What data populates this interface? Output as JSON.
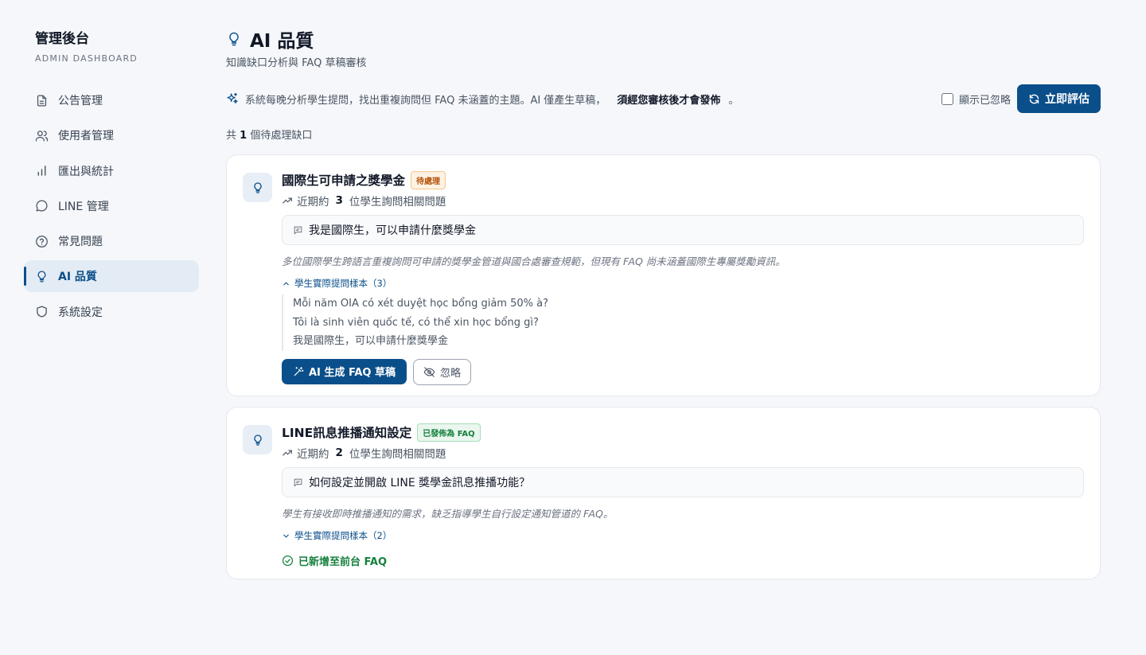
{
  "sidebar": {
    "title": "管理後台",
    "subtitle": "ADMIN DASHBOARD",
    "items": [
      {
        "label": "公告管理",
        "icon": "document-icon"
      },
      {
        "label": "使用者管理",
        "icon": "users-icon"
      },
      {
        "label": "匯出與統計",
        "icon": "bar-chart-icon"
      },
      {
        "label": "LINE 管理",
        "icon": "chat-bubble-icon"
      },
      {
        "label": "常見問題",
        "icon": "help-circle-icon"
      },
      {
        "label": "AI 品質",
        "icon": "lightbulb-icon",
        "active": true
      },
      {
        "label": "系統設定",
        "icon": "shield-icon"
      }
    ]
  },
  "header": {
    "title": "AI 品質",
    "subtitle": "知識缺口分析與 FAQ 草稿審核"
  },
  "info": {
    "text": "系統每晚分析學生提問，找出重複詢問但 FAQ 未涵蓋的主題。AI 僅產生草稿，",
    "bold": "須經您審核後才會發佈",
    "end": "。",
    "show_ignored_label": "顯示已忽略",
    "show_ignored_checked": false,
    "evaluate_button": "立即評估"
  },
  "count": {
    "prefix": "共",
    "number": "1",
    "suffix": "個待處理缺口"
  },
  "gaps": [
    {
      "title": "國際生可申請之獎學金",
      "badge": "待處理",
      "trend_prefix": "近期約",
      "trend_count": "3",
      "trend_suffix": "位學生詢問相關問題",
      "question": "我是國際生，可以申請什麼獎學金",
      "description": "多位國際學生跨語言重複詢問可申請的獎學金管道與國合處審查規範，但現有 FAQ 尚未涵蓋國際生專屬獎勵資訊。",
      "samples_label": "學生實際提問樣本（3）",
      "samples_expanded": true,
      "samples": [
        "Mỗi năm OIA có xét duyệt học bổng giảm 50% à?",
        "Tôi là sinh viên quốc tế, có thể xin học bổng gì?",
        "我是國際生，可以申請什麼獎學金"
      ],
      "ai_button": "AI 生成 FAQ 草稿",
      "ignore_button": "忽略"
    },
    {
      "title": "LINE訊息推播通知設定",
      "badge": "已發佈為 FAQ",
      "trend_prefix": "近期約",
      "trend_count": "2",
      "trend_suffix": "位學生詢問相關問題",
      "question": "如何設定並開啟 LINE 獎學金訊息推播功能？",
      "description": "學生有接收即時推播通知的需求，缺乏指導學生自行設定通知管道的 FAQ。",
      "samples_label": "學生實際提問樣本（2）",
      "samples_expanded": false,
      "added_label": "已新增至前台 FAQ"
    }
  ],
  "colors": {
    "primary": "#0b4f8a",
    "pending": "#b45309",
    "published": "#15803d"
  }
}
